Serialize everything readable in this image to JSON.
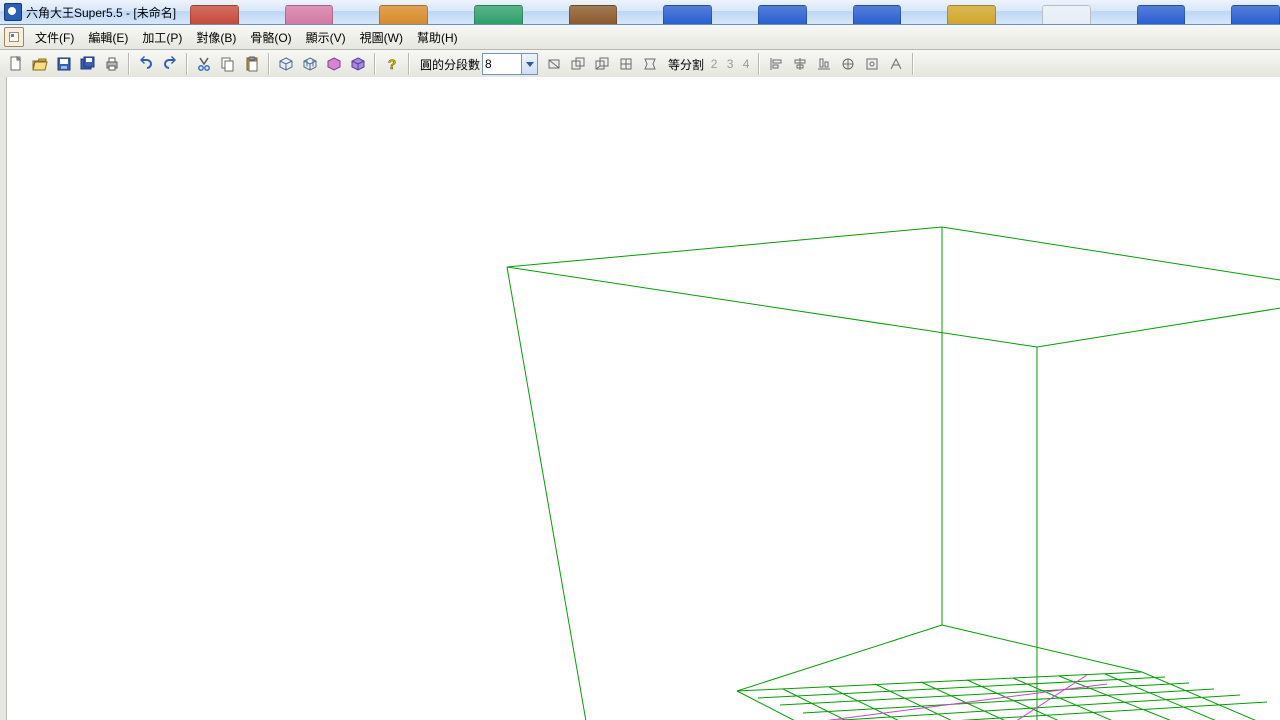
{
  "window": {
    "title": "六角大王Super5.5 - [未命名]"
  },
  "menu": {
    "items": [
      {
        "label": "文件(F)"
      },
      {
        "label": "編輯(E)"
      },
      {
        "label": "加工(P)"
      },
      {
        "label": "對像(B)"
      },
      {
        "label": "骨骼(O)"
      },
      {
        "label": "顯示(V)"
      },
      {
        "label": "視圖(W)"
      },
      {
        "label": "幫助(H)"
      }
    ]
  },
  "toolbar": {
    "icons": {
      "new": "new-file-icon",
      "open": "open-icon",
      "save": "save-icon",
      "saveall": "save-all-icon",
      "print": "print-icon",
      "undo": "undo-icon",
      "redo": "redo-icon",
      "cut": "cut-icon",
      "copy": "copy-icon",
      "paste": "paste-icon",
      "prim1": "primitive-1-icon",
      "prim2": "primitive-2-icon",
      "prim3": "primitive-3-icon",
      "prim4": "primitive-4-icon",
      "help": "help-icon"
    },
    "circle_seg_label": "圓的分段數",
    "circle_seg_value": "8",
    "shape_icons": {
      "s1": "shape-tool-1-icon",
      "s2": "shape-tool-2-icon",
      "s3": "shape-tool-3-icon",
      "s4": "shape-tool-4-icon",
      "s5": "shape-tool-5-icon"
    },
    "equal_split_label": "等分割",
    "split_numbers": [
      "2",
      "3",
      "4"
    ],
    "align_icons": {
      "a1": "align-1-icon",
      "a2": "align-2-icon",
      "a3": "align-3-icon",
      "a4": "align-4-icon",
      "a5": "align-5-icon",
      "a6": "align-6-icon"
    }
  },
  "bg_thumb_colors": [
    "#c64a3a",
    "#d47aa4",
    "#d98a2a",
    "#2fa06a",
    "#8a5a2a",
    "#2a5fd0",
    "#2a5fd0",
    "#2a5fd0",
    "#d0a62a",
    "#e8eef6",
    "#2a5fd0",
    "#2a5fd0"
  ]
}
